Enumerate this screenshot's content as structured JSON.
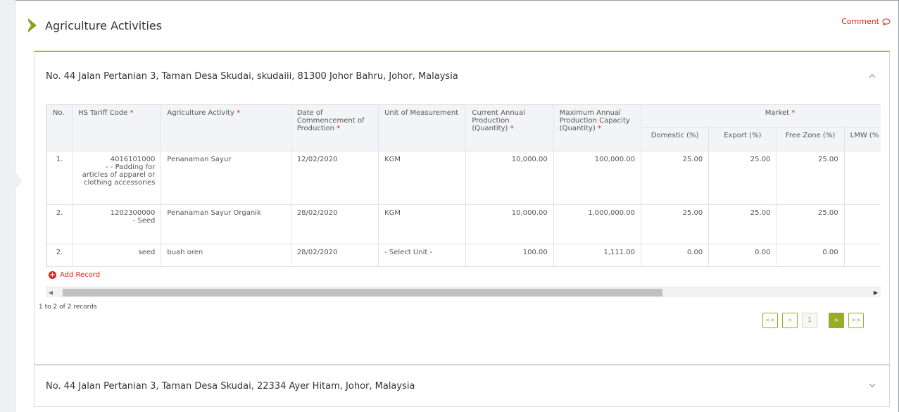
{
  "header": {
    "title": "Agriculture Activities",
    "comment_label": "Comment"
  },
  "panel1": {
    "address": "No. 44 Jalan Pertanian 3, Taman Desa Skudai, skudaiii, 81300 Johor Bahru, Johor, Malaysia",
    "columns": {
      "no": "No.",
      "hs_tariff": "HS Tariff Code",
      "activity": "Agriculture Activity",
      "date": "Date of Commencement of Production",
      "unit": "Unit of Measurement",
      "current_prod": "Current Annual Production (Quantity)",
      "max_prod": "Maximum Annual Production Capacity (Quantity)",
      "market": "Market",
      "domestic": "Domestic (%)",
      "export": "Export (%)",
      "free_zone": "Free Zone (%)",
      "lmw": "LMW (%"
    },
    "rows": [
      {
        "no": "1.",
        "hs_code": "4016101000",
        "hs_desc": "- - Padding for articles of apparel or clothing accessories",
        "activity": "Penanaman Sayur",
        "date": "12/02/2020",
        "unit": "KGM",
        "current": "10,000.00",
        "max": "100,000.00",
        "domestic": "25.00",
        "export": "25.00",
        "free_zone": "25.00",
        "lmw": ""
      },
      {
        "no": "2.",
        "hs_code": "1202300000",
        "hs_desc": "- Seed",
        "activity": "Penanaman Sayur Organik",
        "date": "28/02/2020",
        "unit": "KGM",
        "current": "10,000.00",
        "max": "1,000,000.00",
        "domestic": "25.00",
        "export": "25.00",
        "free_zone": "25.00",
        "lmw": ""
      },
      {
        "no": "2.",
        "hs_code": "seed",
        "hs_desc": "",
        "activity": "buah oren",
        "date": "28/02/2020",
        "unit": "- Select Unit -",
        "current": "100.00",
        "max": "1,111.00",
        "domestic": "0.00",
        "export": "0.00",
        "free_zone": "0.00",
        "lmw": ""
      }
    ],
    "add_record_label": "Add Record",
    "records_info": "1 to 2 of 2 records",
    "pager": {
      "first": "<<",
      "prev": "<",
      "page": "1",
      "next": ">",
      "last": ">>"
    }
  },
  "panel2": {
    "address": "No. 44 Jalan Pertanian 3, Taman Desa Skudai, 22334 Ayer Hitam, Johor, Malaysia"
  },
  "colors": {
    "accent": "#9aab2a",
    "required": "#d9261c",
    "header_bg": "#f3f4f6"
  },
  "icons": {
    "header_mark": "chevron-right-mark",
    "comment": "speech-bubble-icon",
    "collapse": "chevron-up-icon",
    "expand": "chevron-down-icon",
    "add": "plus-circle-icon"
  }
}
